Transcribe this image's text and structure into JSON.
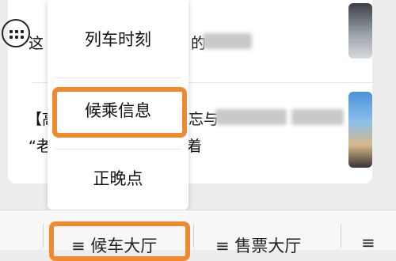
{
  "feed": {
    "row1_prefix": "这",
    "row1_suffix": "的",
    "row2_prefix": "【高",
    "row2_mid": "忘与",
    "row3_prefix": "“老",
    "row3_suffix": "着"
  },
  "menu": {
    "items": [
      "列车时刻",
      "候乘信息",
      "正晚点"
    ],
    "highlighted_index": 1,
    "highlight_color": "#ef8a2e"
  },
  "bottom_bar": {
    "tabs": [
      "≡ 候车大厅",
      "≡ 售票大厅",
      "≡"
    ],
    "active_index": 0
  }
}
